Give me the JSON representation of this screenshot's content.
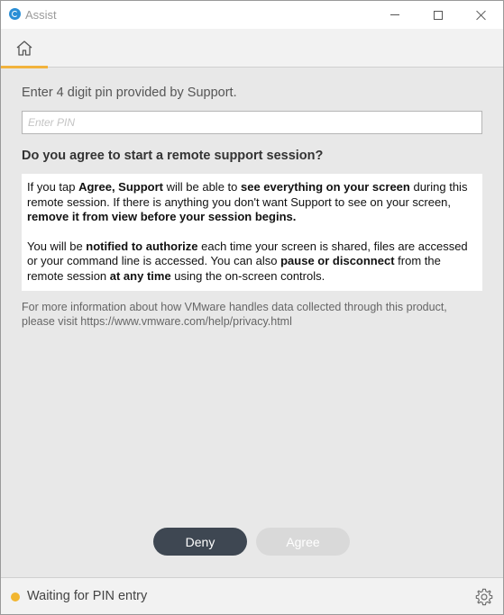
{
  "window": {
    "title": "Assist"
  },
  "tabs": [
    {
      "name": "home",
      "icon": "home-icon",
      "active": true
    }
  ],
  "main": {
    "pin_label": "Enter 4 digit pin provided by Support.",
    "pin_placeholder": "Enter PIN",
    "pin_value": "",
    "question": "Do you agree to start a remote support session?",
    "info_p1": {
      "t1": "If you tap ",
      "b1": "Agree, Support",
      "t2": " will be able to ",
      "b2": "see everything on your screen",
      "t3": " during this remote session. If there is anything you don't want Support to see on your screen, ",
      "b3": "remove it from view before your session begins."
    },
    "info_p2": {
      "t1": "You will be ",
      "b1": "notified to authorize",
      "t2": " each time your screen is shared, files are accessed or your command line is accessed. You can also ",
      "b2": "pause or disconnect",
      "t3": " from the remote session ",
      "b3": "at any time",
      "t4": " using the on-screen controls."
    },
    "privacy_note": "For more information about how VMware handles data collected through this product, please visit https://www.vmware.com/help/privacy.html"
  },
  "buttons": {
    "deny": "Deny",
    "agree": "Agree",
    "agree_enabled": false
  },
  "status": {
    "text": "Waiting for PIN entry",
    "color": "#f2b630"
  },
  "colors": {
    "accent": "#f2b33d",
    "deny_bg": "#3e4752",
    "agree_disabled_bg": "#d9d9d9"
  }
}
